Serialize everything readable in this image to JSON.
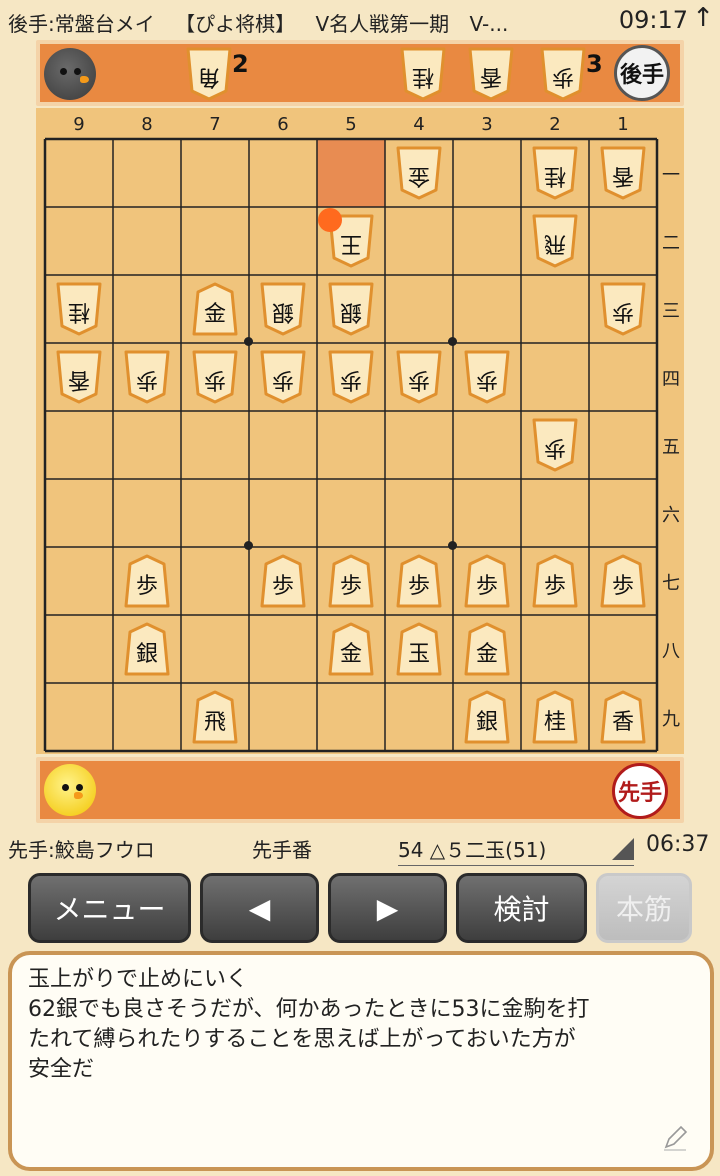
{
  "status_bar": {
    "gote_player": "後手:常盤台メイ",
    "app_title": "【ぴよ将棋】",
    "event": "V名人戦第一期",
    "truncated": "V-...",
    "time": "09:17",
    "arrow_icon": "up-arrow-icon"
  },
  "gote_hand": {
    "badge": "後手",
    "pieces": [
      {
        "char": "角",
        "count": "2"
      },
      {
        "char": "桂",
        "count": ""
      },
      {
        "char": "香",
        "count": ""
      },
      {
        "char": "歩",
        "count": "3"
      }
    ]
  },
  "sente_hand": {
    "badge": "先手",
    "pieces": []
  },
  "board": {
    "col_labels": [
      "9",
      "8",
      "7",
      "6",
      "5",
      "4",
      "3",
      "2",
      "1"
    ],
    "row_labels": [
      "一",
      "二",
      "三",
      "四",
      "五",
      "六",
      "七",
      "八",
      "九"
    ],
    "last_move_square": "5一",
    "pieces": [
      {
        "sq": "4-1",
        "char": "金",
        "owner": "gote"
      },
      {
        "sq": "2-1",
        "char": "桂",
        "owner": "gote"
      },
      {
        "sq": "1-1",
        "char": "香",
        "owner": "gote"
      },
      {
        "sq": "5-2",
        "char": "王",
        "owner": "gote"
      },
      {
        "sq": "2-2",
        "char": "飛",
        "owner": "gote"
      },
      {
        "sq": "9-3",
        "char": "桂",
        "owner": "gote"
      },
      {
        "sq": "7-3",
        "char": "金",
        "owner": "sente"
      },
      {
        "sq": "6-3",
        "char": "銀",
        "owner": "gote"
      },
      {
        "sq": "5-3",
        "char": "銀",
        "owner": "gote"
      },
      {
        "sq": "1-3",
        "char": "歩",
        "owner": "gote"
      },
      {
        "sq": "9-4",
        "char": "香",
        "owner": "gote"
      },
      {
        "sq": "8-4",
        "char": "歩",
        "owner": "gote"
      },
      {
        "sq": "7-4",
        "char": "歩",
        "owner": "gote"
      },
      {
        "sq": "6-4",
        "char": "歩",
        "owner": "gote"
      },
      {
        "sq": "5-4",
        "char": "歩",
        "owner": "gote"
      },
      {
        "sq": "4-4",
        "char": "歩",
        "owner": "gote"
      },
      {
        "sq": "3-4",
        "char": "歩",
        "owner": "gote"
      },
      {
        "sq": "2-5",
        "char": "歩",
        "owner": "gote"
      },
      {
        "sq": "8-7",
        "char": "歩",
        "owner": "sente"
      },
      {
        "sq": "6-7",
        "char": "歩",
        "owner": "sente"
      },
      {
        "sq": "5-7",
        "char": "歩",
        "owner": "sente"
      },
      {
        "sq": "4-7",
        "char": "歩",
        "owner": "sente"
      },
      {
        "sq": "3-7",
        "char": "歩",
        "owner": "sente"
      },
      {
        "sq": "2-7",
        "char": "歩",
        "owner": "sente"
      },
      {
        "sq": "1-7",
        "char": "歩",
        "owner": "sente"
      },
      {
        "sq": "8-8",
        "char": "銀",
        "owner": "sente"
      },
      {
        "sq": "5-8",
        "char": "金",
        "owner": "sente"
      },
      {
        "sq": "4-8",
        "char": "玉",
        "owner": "sente"
      },
      {
        "sq": "3-8",
        "char": "金",
        "owner": "sente"
      },
      {
        "sq": "7-9",
        "char": "飛",
        "owner": "sente"
      },
      {
        "sq": "3-9",
        "char": "銀",
        "owner": "sente"
      },
      {
        "sq": "2-9",
        "char": "桂",
        "owner": "sente"
      },
      {
        "sq": "1-9",
        "char": "香",
        "owner": "sente"
      }
    ]
  },
  "info": {
    "sente_player": "先手:鮫島フウロ",
    "turn": "先手番",
    "move": "54 △５二玉(51)",
    "clock": "06:37"
  },
  "buttons": {
    "menu": "メニュー",
    "prev": "◀",
    "next": "▶",
    "analyze": "検討",
    "mainline": "本筋"
  },
  "comment": {
    "lines": [
      "玉上がりで止めにいく",
      "62銀でも良さそうだが、何かあったときに53に金駒を打",
      "たれて縛られたりすることを思えば上がっておいた方が",
      "安全だ"
    ],
    "edit_icon": "pencil-icon"
  },
  "colors": {
    "board": "#f0c47c",
    "hand": "#e98941",
    "highlight": "#e88c52",
    "move_dot": "#ff6a1e",
    "button": "#4a4a4a"
  }
}
